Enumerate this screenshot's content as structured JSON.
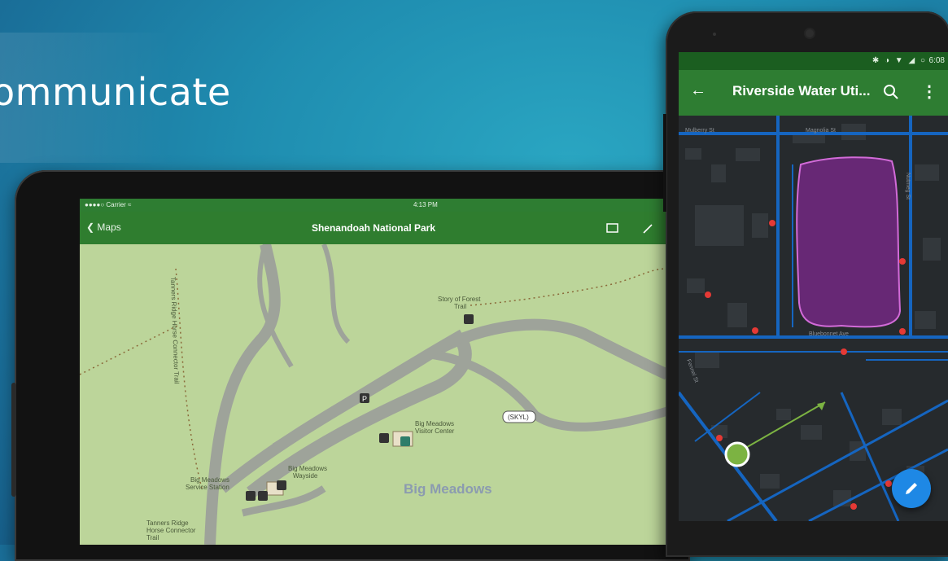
{
  "slide": {
    "title": "ommunicate"
  },
  "tablet": {
    "status": {
      "carrier": "●●●●○ Carrier ≈",
      "time": "4:13 PM"
    },
    "nav": {
      "back_label": "Maps",
      "title": "Shenandoah National Park",
      "layers_icon": "layers-icon",
      "edit_icon": "pencil-icon"
    },
    "map": {
      "labels": {
        "trail_connector": "Tanners Ridge Horse Connector Trail",
        "story_trail_line1": "Story of Forest",
        "story_trail_line2": "Trail",
        "visitor_center_line1": "Big Meadows",
        "visitor_center_line2": "Visitor Center",
        "service_line1": "Big Meadows",
        "service_line2": "Service Station",
        "wayside_line1": "Big Meadows",
        "wayside_line2": "Wayside",
        "area": "Big Meadows",
        "ridge_line1": "Tanners Ridge",
        "ridge_line2": "Horse Connector",
        "ridge_line3": "Trail",
        "road_shield": "(SKYL)"
      }
    }
  },
  "phone": {
    "status": {
      "icons": "✱ ◑ ▼ ◢ ○",
      "time": "6:08"
    },
    "appbar": {
      "title": "Riverside Water Uti...",
      "back_icon": "arrow-left-icon",
      "search_icon": "search-icon",
      "more_icon": "more-vert-icon"
    },
    "map": {
      "streets": {
        "top_left": "Mulberry St",
        "top_right": "Magnolia St",
        "middle": "Bluebonnet Ave",
        "right": "Nutmeg St",
        "lower_left": "Fennel St"
      }
    },
    "fab_icon": "pencil-icon"
  },
  "colors": {
    "accent_green": "#2e7d32",
    "map_green": "#bcd59a",
    "utility_blue": "#1565c0",
    "polygon_purple": "#9c27b0",
    "point_red": "#e53935",
    "fab_blue": "#1e88e5"
  }
}
